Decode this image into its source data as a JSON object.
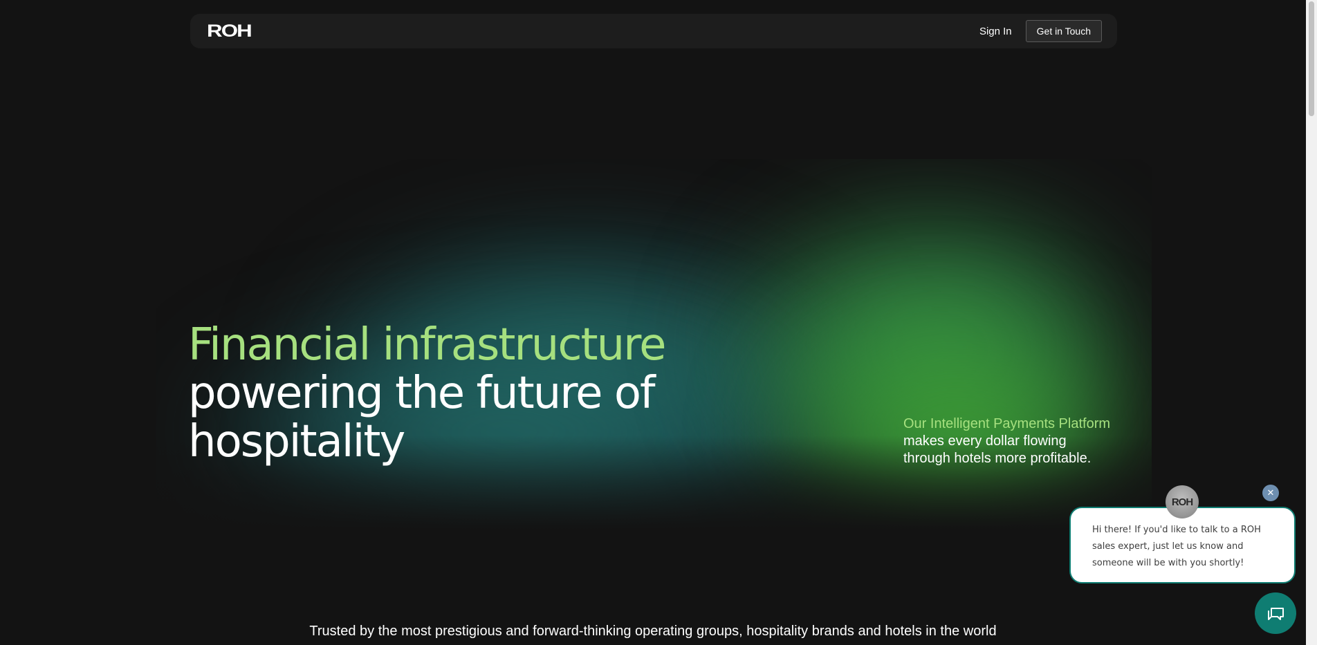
{
  "nav": {
    "logo": "ROH",
    "sign_in": "Sign In",
    "cta": "Get in Touch"
  },
  "hero": {
    "title_accent": "Financial infrastructure",
    "title_line2": "powering the future of",
    "title_line3": "hospitality",
    "tagline_accent": "Our Intelligent Payments Platform",
    "tagline_line2": "makes every dollar flowing",
    "tagline_line3": "through hotels more profitable."
  },
  "trusted_text": "Trusted by the most prestigious and forward-thinking operating groups, hospitality brands and hotels in the world",
  "chat": {
    "avatar_text": "ROH",
    "close_icon": "close-icon",
    "message": "Hi there! If you'd like to talk to a ROH sales expert, just let us know and someone will be with you shortly!",
    "launcher_icon": "chat-icon"
  },
  "colors": {
    "accent": "#a6e07f",
    "background": "#131313",
    "chat_teal": "#0f7d72"
  }
}
